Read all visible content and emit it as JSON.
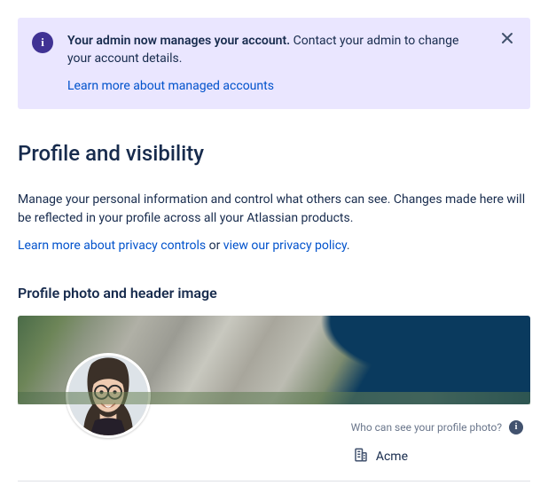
{
  "banner": {
    "strong": "Your admin now manages your account.",
    "rest": "Contact your admin to change your account details.",
    "link": "Learn more about managed accounts"
  },
  "page": {
    "title": "Profile and visibility",
    "desc": "Manage your personal information and control what others can see. Changes made here will be reflected in your profile across all your Atlassian products.",
    "linkPrivacy": "Learn more about privacy controls",
    "or": " or ",
    "linkPolicy": "view our privacy policy",
    "period": "."
  },
  "section": {
    "title": "Profile photo and header image",
    "whoCanSee": "Who can see your profile photo?",
    "orgName": "Acme"
  }
}
